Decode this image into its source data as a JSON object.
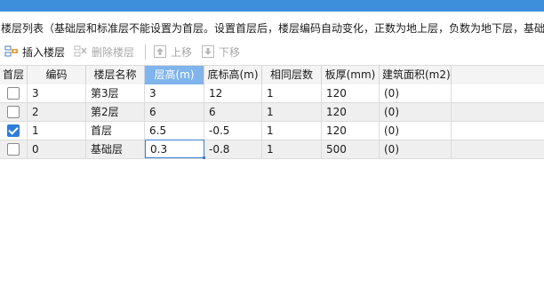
{
  "description": "楼层列表（基础层和标准层不能设置为首层。设置首层后，楼层编码自动变化，正数为地上层，负数为地下层，基础",
  "toolbar": {
    "insert_floor": "插入楼层",
    "delete_floor": "删除楼层",
    "move_up": "上移",
    "move_down": "下移"
  },
  "table": {
    "headers": {
      "first_floor": "首层",
      "code": "编码",
      "floor_name": "楼层名称",
      "floor_height": "层高(m)",
      "bottom_elev": "底标高(m)",
      "same_count": "相同层数",
      "slab_thickness": "板厚(mm)",
      "building_area": "建筑面积(m2)"
    },
    "rows": [
      {
        "checked": false,
        "code": "3",
        "name": "第3层",
        "height": "3",
        "bottom": "12",
        "count": "1",
        "slab": "120",
        "area": "(0)"
      },
      {
        "checked": false,
        "code": "2",
        "name": "第2层",
        "height": "6",
        "bottom": "6",
        "count": "1",
        "slab": "120",
        "area": "(0)"
      },
      {
        "checked": true,
        "code": "1",
        "name": "首层",
        "height": "6.5",
        "bottom": "-0.5",
        "count": "1",
        "slab": "120",
        "area": "(0)"
      },
      {
        "checked": false,
        "code": "0",
        "name": "基础层",
        "height": "0.3",
        "bottom": "-0.8",
        "count": "1",
        "slab": "500",
        "area": "(0)"
      }
    ]
  },
  "colors": {
    "title_bar": "#3d8fdc",
    "header_active": "#7fb4ec",
    "check_fill": "#2f7ed8"
  },
  "icons": [
    "insert-floor-icon",
    "delete-floor-icon",
    "move-up-icon",
    "move-down-icon"
  ]
}
